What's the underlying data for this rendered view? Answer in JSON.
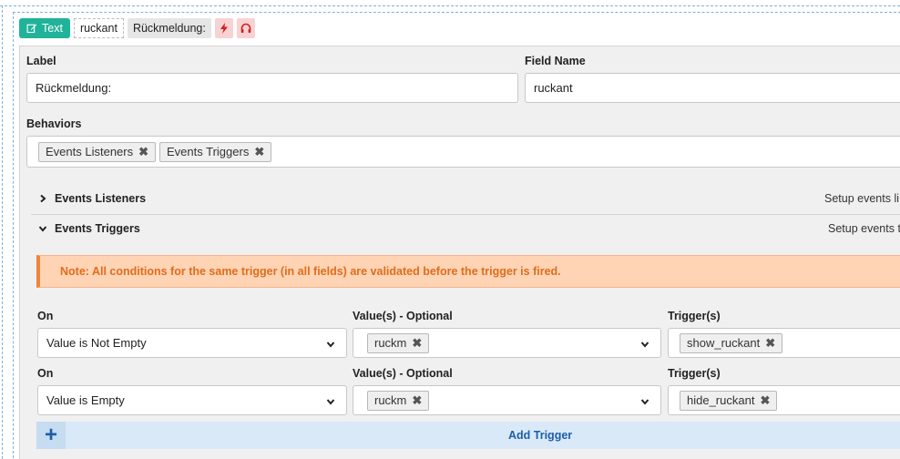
{
  "toolbar": {
    "type_label": "Text",
    "field_name": "ruckant",
    "label": "Rückmeldung:",
    "icons": [
      "lightning-icon",
      "headphones-icon"
    ],
    "accent_color": "#20b39a"
  },
  "form": {
    "label_heading": "Label",
    "label_value": "Rückmeldung:",
    "field_name_heading": "Field Name",
    "field_name_value": "ruckant",
    "behaviors_heading": "Behaviors",
    "behaviors": [
      "Events Listeners",
      "Events Triggers"
    ]
  },
  "accordion": {
    "listeners_title": "Events Listeners",
    "listeners_desc": "Setup events li",
    "triggers_title": "Events Triggers",
    "triggers_desc": "Setup events t"
  },
  "note": "Note: All conditions for the same trigger (in all fields) are validated before the trigger is fired.",
  "triggers": [
    {
      "on_heading": "On",
      "on_value": "Value is Not Empty",
      "values_heading": "Value(s) - Optional",
      "values": [
        "ruckm"
      ],
      "triggers_heading": "Trigger(s)",
      "trigger_tags": [
        "show_ruckant"
      ]
    },
    {
      "on_heading": "On",
      "on_value": "Value is Empty",
      "values_heading": "Value(s) - Optional",
      "values": [
        "ruckm"
      ],
      "triggers_heading": "Trigger(s)",
      "trigger_tags": [
        "hide_ruckant"
      ]
    }
  ],
  "add_trigger": {
    "plus": "+",
    "label": "Add Trigger"
  }
}
